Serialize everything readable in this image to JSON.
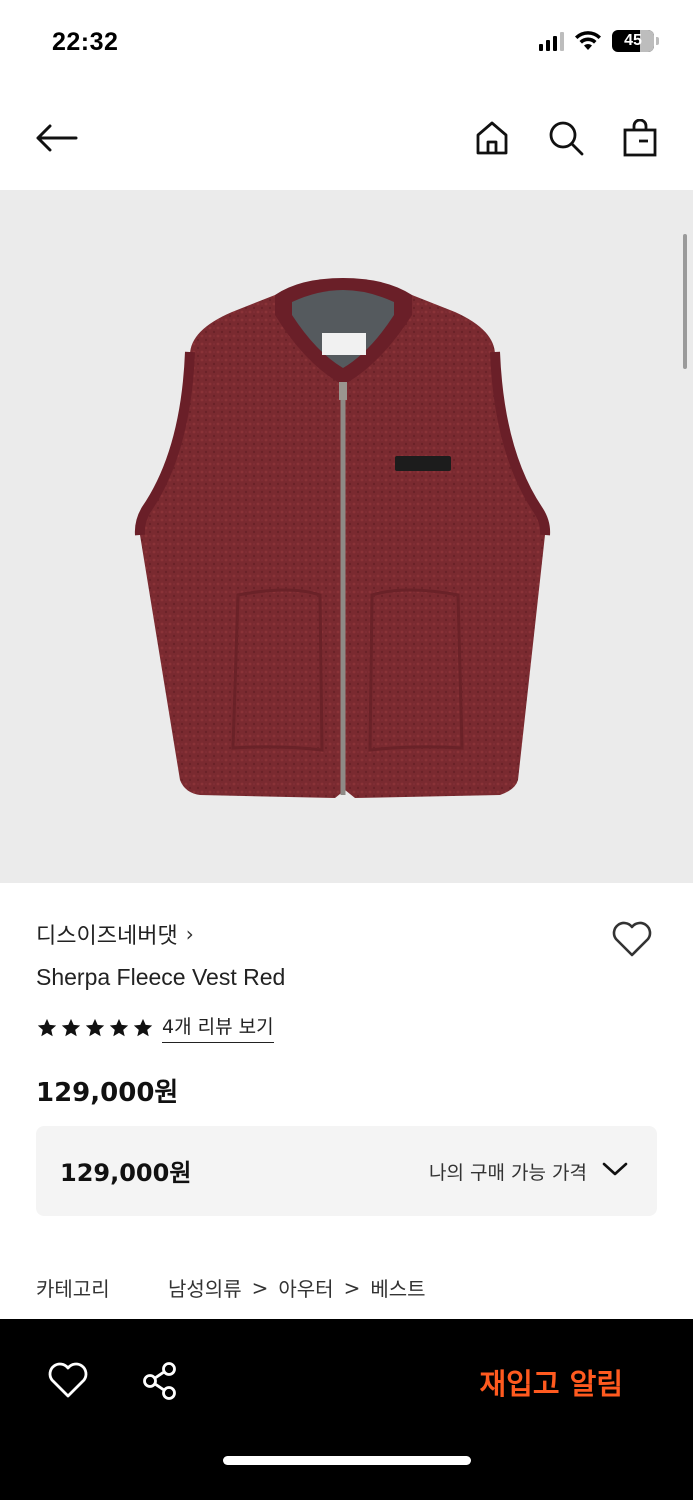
{
  "status_bar": {
    "time": "22:32",
    "battery": "45"
  },
  "nav": {
    "back_icon": "arrow-left-icon",
    "home_icon": "home-icon",
    "search_icon": "search-icon",
    "bag_icon": "shopping-bag-icon"
  },
  "product": {
    "brand": "디스이즈네버댓",
    "brand_chevron": "›",
    "name": "Sherpa Fleece Vest Red",
    "rating": {
      "stars": 5,
      "max": 5
    },
    "review_link": "4개 리뷰 보기",
    "price": "129,000원",
    "image_color": "#7a2a30"
  },
  "price_box": {
    "value": "129,000원",
    "label": "나의 구매 가능 가격"
  },
  "category": {
    "label": "카테고리",
    "path": [
      "남성의류",
      "아우터",
      "베스트"
    ],
    "separator": ">"
  },
  "bottom_bar": {
    "restock_label": "재입고 알림",
    "restock_color": "#ff5a1f"
  }
}
